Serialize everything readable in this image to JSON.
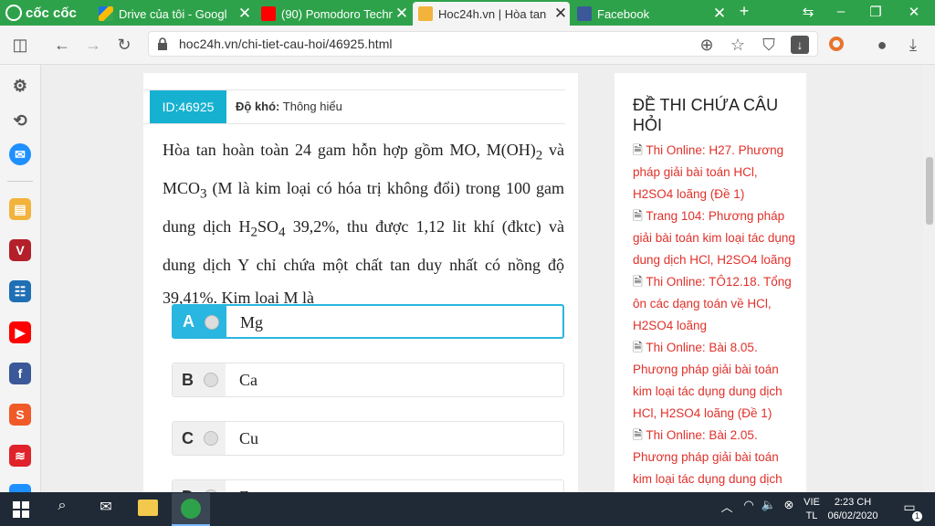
{
  "browser": {
    "brand": "cốc cốc",
    "tabs": [
      {
        "title": "Drive của tôi - Googl",
        "favicon": "google-drive-icon",
        "close": "✕"
      },
      {
        "title": "(90) Pomodoro Techn",
        "favicon": "youtube-icon",
        "close": "✕"
      },
      {
        "title": "Hoc24h.vn | Hòa tan",
        "favicon": "book-icon",
        "close": "✕"
      },
      {
        "title": "Facebook",
        "favicon": "facebook-icon",
        "close": "✕"
      }
    ],
    "new_tab": "+",
    "url": "hoc24h.vn/chi-tiet-cau-hoi/46925.html"
  },
  "question": {
    "id_label": "ID:46925",
    "difficulty_label": "Độ khó:",
    "difficulty_value": "Thông hiểu"
  },
  "options": [
    {
      "letter": "A",
      "text": "Mg",
      "selected": true
    },
    {
      "letter": "B",
      "text": "Ca",
      "selected": false
    },
    {
      "letter": "C",
      "text": "Cu",
      "selected": false
    },
    {
      "letter": "D",
      "text": "Zn",
      "selected": false
    }
  ],
  "sidebar": {
    "title": "ĐỀ THI CHỨA CÂU HỎI",
    "links": [
      "Thi Online: H27. Phương pháp giải bài toán HCl, H2SO4 loãng (Đề 1)",
      "Trang 104: Phương pháp giải bài toán kim loại tác dụng dung dịch HCl, H2SO4 loãng",
      "Thi Online: TÔ12.18. Tổng ôn các dạng toán về HCl, H2SO4 loãng",
      "Thi Online: Bài 8.05. Phương pháp giải bài toán kim loại tác dụng dung dịch HCl, H2SO4 loãng (Đề 1)",
      "Thi Online: Bài 2.05. Phương pháp giải bài toán kim loại tác dụng dung dịch HCl,"
    ]
  },
  "taskbar": {
    "language_line1": "VIE",
    "language_line2": "TL",
    "time": "2:23 CH",
    "date": "06/02/2020",
    "notification_count": "1"
  },
  "colors": {
    "tabbar": "#2ea24a",
    "accent": "#16b1d0",
    "link": "#e0312b",
    "taskbar": "#1f2a36"
  }
}
